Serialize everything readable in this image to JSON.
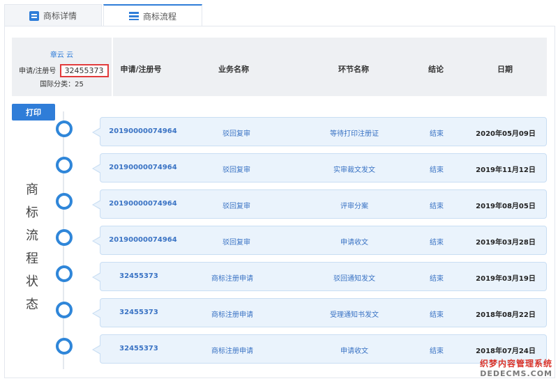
{
  "tabs": [
    {
      "label": "商标详情",
      "icon": "document-icon",
      "active": false
    },
    {
      "label": "商标流程",
      "icon": "list-icon",
      "active": true
    }
  ],
  "info": {
    "name": "章云 云",
    "reg_label": "申请/注册号",
    "reg_number": "32455373",
    "class_label": "国际分类：25"
  },
  "table_headers": {
    "reg": "申请/注册号",
    "business": "业务名称",
    "stage": "环节名称",
    "result": "结论",
    "date": "日期"
  },
  "print_label": "打印",
  "status_title": [
    "商",
    "标",
    "流",
    "程",
    "状",
    "态"
  ],
  "rows": [
    {
      "reg": "20190000074964",
      "business": "驳回复审",
      "stage": "等待打印注册证",
      "result": "结束",
      "date": "2020年05月09日"
    },
    {
      "reg": "20190000074964",
      "business": "驳回复审",
      "stage": "实审裁文发文",
      "result": "结束",
      "date": "2019年11月12日"
    },
    {
      "reg": "20190000074964",
      "business": "驳回复审",
      "stage": "评审分案",
      "result": "结束",
      "date": "2019年08月05日"
    },
    {
      "reg": "20190000074964",
      "business": "驳回复审",
      "stage": "申请收文",
      "result": "结束",
      "date": "2019年03月28日"
    },
    {
      "reg": "32455373",
      "business": "商标注册申请",
      "stage": "驳回通知发文",
      "result": "结束",
      "date": "2019年03月19日"
    },
    {
      "reg": "32455373",
      "business": "商标注册申请",
      "stage": "受理通知书发文",
      "result": "结束",
      "date": "2018年08月22日"
    },
    {
      "reg": "32455373",
      "business": "商标注册申请",
      "stage": "申请收文",
      "result": "结束",
      "date": "2018年07月24日"
    }
  ],
  "watermark": {
    "line1": "织梦内容管理系统",
    "line2": "DEDECMS.COM"
  },
  "colors": {
    "accent": "#2f7dd8",
    "highlight": "#e23b3b",
    "row_bg": "#eaf3fc"
  }
}
